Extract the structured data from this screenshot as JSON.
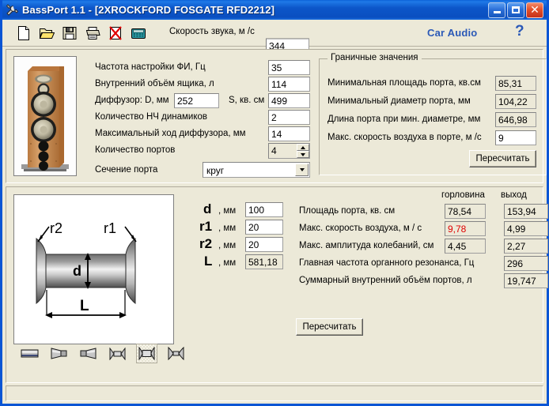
{
  "window": {
    "title": "BassPort 1.1 - [2XROCKFORD FOSGATE RFD2212]",
    "icon": "wrench-screwdriver-icon",
    "minimize_label": "",
    "maximize_label": "",
    "close_label": "✕",
    "accent_titlebar": "#0a55d4",
    "face_color": "#ece9d8"
  },
  "toolbar": {
    "icons": [
      {
        "name": "new-document-icon"
      },
      {
        "name": "open-folder-icon"
      },
      {
        "name": "save-floppy-icon"
      },
      {
        "name": "print-icon"
      },
      {
        "name": "delete-red-x-icon"
      },
      {
        "name": "calculator-icon"
      }
    ],
    "speed_label": "Скорость звука, м /с",
    "speed_value": "344",
    "brand": "Car Audio",
    "brand_color": "#2b59b7",
    "help": "?"
  },
  "top_panel": {
    "speaker_image_alt": "floor-standing-loudspeaker",
    "fields": [
      {
        "label": "Частота настройки ФИ, Гц",
        "value": "35"
      },
      {
        "label": "Внутренний объём ящика, л",
        "value": "114"
      },
      {
        "label": "Диффузор: D, мм",
        "value": "252"
      },
      {
        "label": "S, кв. см",
        "value": "499"
      },
      {
        "label": "Количество НЧ динамиков",
        "value": "2"
      },
      {
        "label": "Максимальный ход диффузора, мм",
        "value": "14"
      },
      {
        "label": "Количество портов",
        "value": "4"
      },
      {
        "label": "Сечение порта",
        "value": "круг"
      }
    ],
    "limits_group": {
      "title": "Граничные значения",
      "rows": [
        {
          "label": "Минимальная площадь порта, кв.см",
          "value": "85,31"
        },
        {
          "label": "Минимальный диаметр порта, мм",
          "value": "104,22"
        },
        {
          "label": "Длина порта при мин. диаметре, мм",
          "value": "646,98"
        },
        {
          "label": "Макс. скорость воздуха в порте, м /с",
          "value": "9"
        }
      ],
      "recalc_label": "Пересчитать"
    }
  },
  "bottom_panel": {
    "diagram": {
      "name": "port-cross-section-diagram",
      "labels": {
        "d": "d",
        "r1": "r1",
        "r2": "r2",
        "L": "L"
      }
    },
    "dims": [
      {
        "symbol": "d",
        "unit": ", мм",
        "value": "100",
        "readonly": false
      },
      {
        "symbol": "r1",
        "unit": ", мм",
        "value": "20",
        "readonly": false
      },
      {
        "symbol": "r2",
        "unit": ", мм",
        "value": "20",
        "readonly": false
      },
      {
        "symbol": "L",
        "unit": ", мм",
        "value": "581,18",
        "readonly": true
      }
    ],
    "col_headers": {
      "throat": "горловина",
      "outlet": "выход"
    },
    "results": [
      {
        "label": "Площадь порта, кв. см",
        "throat": "78,54",
        "outlet": "153,94",
        "throat_red": false
      },
      {
        "label": "Макс. скорость воздуха, м / с",
        "throat": "9,78",
        "outlet": "4,99",
        "throat_red": true
      },
      {
        "label": "Макс. амплитуда колебаний, см",
        "throat": "4,45",
        "outlet": "2,27",
        "throat_red": false
      },
      {
        "label": "Главная частота органного резонанса, Гц",
        "throat": "",
        "outlet": "296",
        "throat_red": false
      },
      {
        "label": "Суммарный внутренний объём портов, л",
        "throat": "",
        "outlet": "19,747",
        "throat_red": false
      }
    ],
    "recalc_label": "Пересчитать",
    "shapes": [
      {
        "name": "shape-straight-tube-icon",
        "selected": false
      },
      {
        "name": "shape-cone-left-icon",
        "selected": false
      },
      {
        "name": "shape-cone-right-icon",
        "selected": false
      },
      {
        "name": "shape-double-flare-icon",
        "selected": false
      },
      {
        "name": "shape-flared-both-icon",
        "selected": true
      },
      {
        "name": "shape-hourglass-icon",
        "selected": false
      }
    ]
  },
  "statusbar": {
    "text": ""
  }
}
